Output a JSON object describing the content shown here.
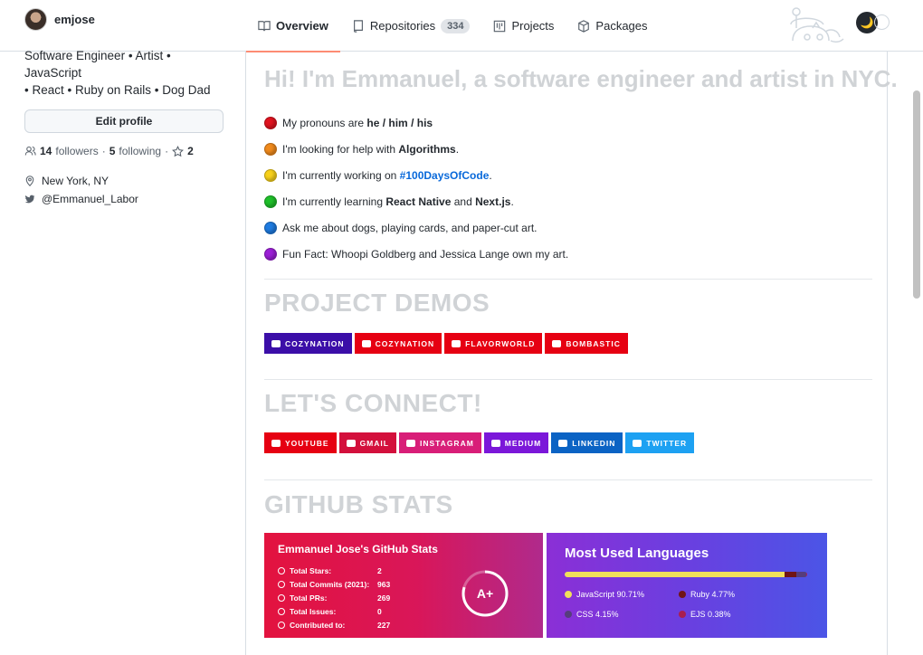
{
  "header": {
    "username": "emjose",
    "tabs": [
      {
        "label": "Overview",
        "icon": "book-icon",
        "active": true
      },
      {
        "label": "Repositories",
        "icon": "repo-icon",
        "count": "334"
      },
      {
        "label": "Projects",
        "icon": "project-icon"
      },
      {
        "label": "Packages",
        "icon": "package-icon"
      }
    ],
    "theme_toggle_icon": "🌙"
  },
  "sidebar": {
    "bio_line1": "Software Engineer • Artist • JavaScript",
    "bio_line2": "• React • Ruby on Rails • Dog Dad",
    "edit_label": "Edit profile",
    "followers_count": "14",
    "followers_label": "followers",
    "sep1": "·",
    "following_count": "5",
    "following_label": "following",
    "sep2": "·",
    "stars_count": "2",
    "location": "New York, NY",
    "twitter": "@Emmanuel_Labor"
  },
  "readme": {
    "heading": "Hi! I'm Emmanuel, a software engineer and artist in NYC.",
    "bullets": [
      {
        "color": "#e0131f",
        "pre": "My pronouns are ",
        "bold": "he / him / his",
        "post": ""
      },
      {
        "color": "#f08a1c",
        "pre": "I'm looking for help with ",
        "bold": "Algorithms",
        "post": "."
      },
      {
        "color": "#f7d01a",
        "pre": "I'm currently working on ",
        "link": "#100DaysOfCode",
        "post": "."
      },
      {
        "color": "#1fbf2a",
        "pre": "I'm currently learning ",
        "bold": "React Native",
        "mid": " and ",
        "bold2": "Next.js",
        "post": "."
      },
      {
        "color": "#1e7be0",
        "pre": "Ask me about dogs, playing cards, and paper-cut art.",
        "post": ""
      },
      {
        "color": "#9b1fd6",
        "pre": "Fun Fact: Whoopi Goldberg and Jessica Lange own my art.",
        "post": ""
      }
    ],
    "demos_title": "PROJECT DEMOS",
    "demos": [
      {
        "label": "COZYNATION",
        "color": "#3b0ea8"
      },
      {
        "label": "COZYNATION",
        "color": "#e60012"
      },
      {
        "label": "FLAVORWORLD",
        "color": "#e60012"
      },
      {
        "label": "BOMBASTIC",
        "color": "#e60012"
      }
    ],
    "connect_title": "LET'S CONNECT!",
    "connect": [
      {
        "label": "YOUTUBE",
        "color": "#e60012"
      },
      {
        "label": "GMAIL",
        "color": "#d3103c"
      },
      {
        "label": "INSTAGRAM",
        "color": "#d81e78"
      },
      {
        "label": "MEDIUM",
        "color": "#7b17d9"
      },
      {
        "label": "LINKEDIN",
        "color": "#0b63c4"
      },
      {
        "label": "TWITTER",
        "color": "#1da1f2"
      }
    ],
    "stats_title": "GITHUB STATS"
  },
  "stats_card": {
    "title": "Emmanuel Jose's GitHub Stats",
    "rows": [
      {
        "label": "Total Stars:",
        "value": "2"
      },
      {
        "label": "Total Commits (2021):",
        "value": "963"
      },
      {
        "label": "Total PRs:",
        "value": "269"
      },
      {
        "label": "Total Issues:",
        "value": "0"
      },
      {
        "label": "Contributed to:",
        "value": "227"
      }
    ],
    "grade": "A+"
  },
  "langs_card": {
    "title": "Most Used Languages",
    "langs": [
      {
        "name": "JavaScript 90.71%",
        "pct": 90.71,
        "color": "#f1e05a"
      },
      {
        "name": "Ruby 4.77%",
        "pct": 4.77,
        "color": "#701516"
      },
      {
        "name": "CSS 4.15%",
        "pct": 4.15,
        "color": "#563d7c"
      },
      {
        "name": "EJS 0.38%",
        "pct": 0.38,
        "color": "#a91e50"
      }
    ]
  }
}
